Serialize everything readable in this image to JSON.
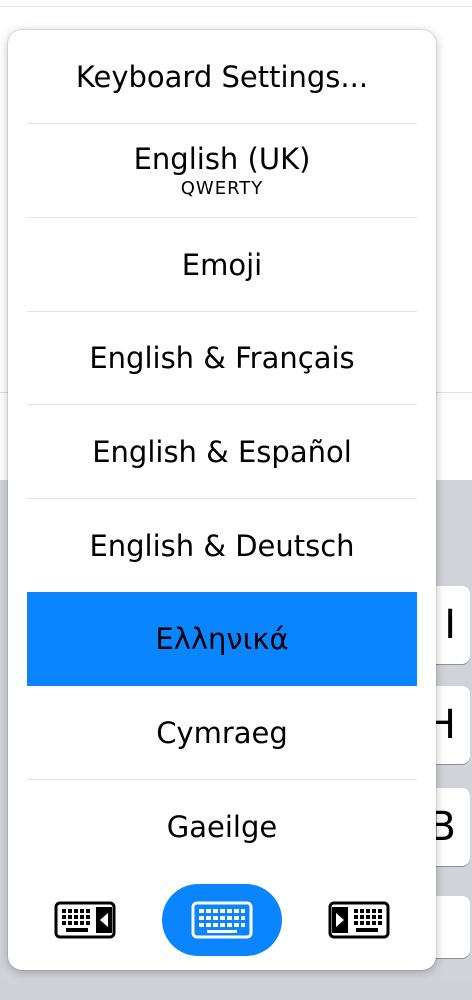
{
  "menu": {
    "items": [
      {
        "label": "Keyboard Settings...",
        "sub": ""
      },
      {
        "label": "English (UK)",
        "sub": "QWERTY"
      },
      {
        "label": "Emoji",
        "sub": ""
      },
      {
        "label": "English & Français",
        "sub": ""
      },
      {
        "label": "English & Español",
        "sub": ""
      },
      {
        "label": "English & Deutsch",
        "sub": ""
      },
      {
        "label": "Ελληνικά",
        "sub": ""
      },
      {
        "label": "Cymraeg",
        "sub": ""
      },
      {
        "label": "Gaeilge",
        "sub": ""
      }
    ],
    "selected_index": 6
  },
  "switcher": {
    "left_icon": "keyboard-left-icon",
    "center_icon": "keyboard-full-icon",
    "right_icon": "keyboard-right-icon"
  },
  "background_keys": [
    "I",
    "H",
    "B"
  ],
  "colors": {
    "accent": "#0a84ff",
    "keyboard_bg": "#d1d3d9"
  }
}
